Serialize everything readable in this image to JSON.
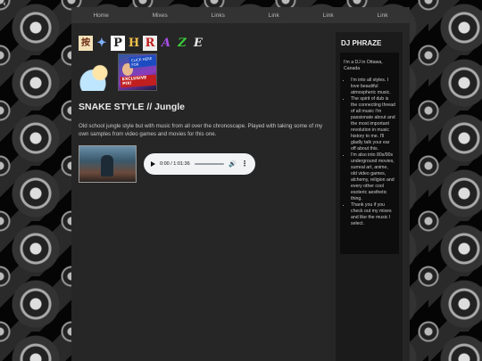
{
  "top_left_icon": "back-arrow-icon",
  "top_left_glyph": "‹",
  "nav": [
    {
      "label": "Home"
    },
    {
      "label": "Mixes"
    },
    {
      "label": "Links"
    },
    {
      "label": "Link"
    },
    {
      "label": "Link"
    },
    {
      "label": "Link"
    }
  ],
  "logo": {
    "alt": "DJ PHRAZE logo",
    "glyphs": [
      "按",
      "✦",
      "P",
      "H",
      "R",
      "A",
      "Z",
      "E"
    ]
  },
  "gifs": {
    "badge_top": "CLICK HERE FOR",
    "badge_bottom": "EXCLUSIVE PIX!"
  },
  "main": {
    "title": "SNAKE STYLE // Jungle",
    "description": "Old school jungle style but with music from all over the chronoscape. Played with taking some of my own samples from video games and movies for this one."
  },
  "player": {
    "time": "0:00 / 1:01:36",
    "progress": 0
  },
  "sidebar": {
    "title": "DJ PHRAZE",
    "intro": "I'm a DJ in Ottawa, Canada",
    "items": [
      "I'm into all styles. I love beautiful atmospheric music.",
      "The spirit of dub is the connecting thread of all music I'm passionate about and the most important revolution in music history to me. I'll gladly talk your ear off about this.",
      "I'm also into 80s/90s underground movies, surreal art, anime, old video games, alchemy, religion and every other cool esoteric aesthetic thing.",
      "Thank you if you check out my mixes and like the music I select."
    ]
  },
  "colors": {
    "page_panel": "#262626",
    "nav_bar": "#333333",
    "sidebar": "#1b1b1b",
    "text": "#c8c8c8"
  }
}
